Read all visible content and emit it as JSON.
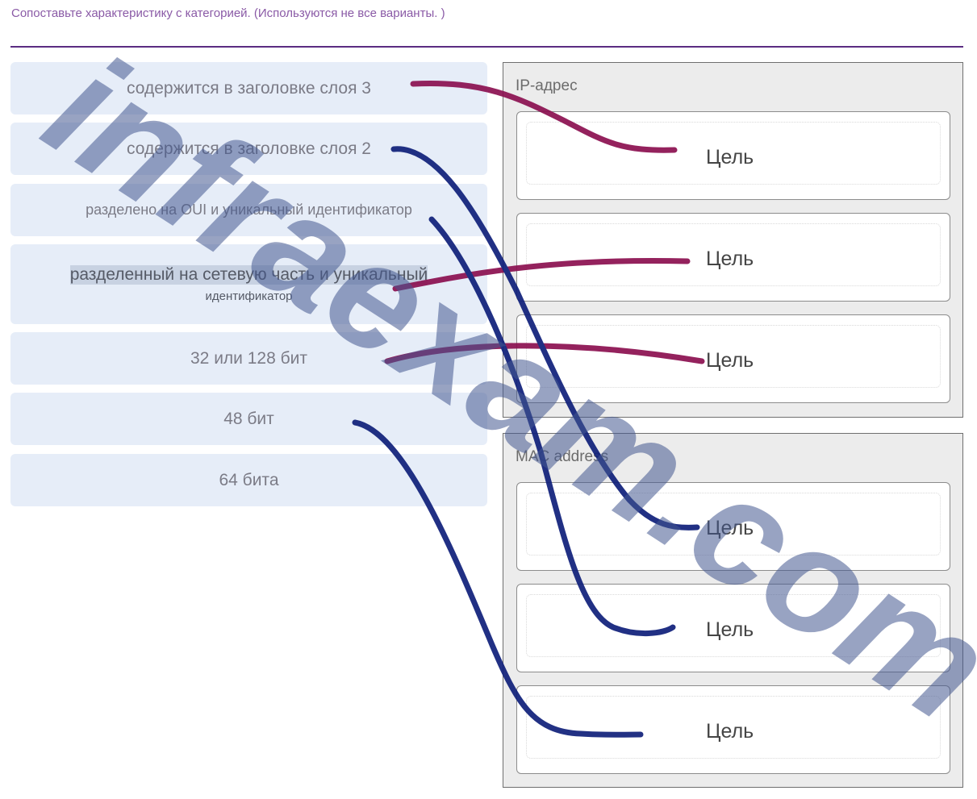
{
  "instruction": "Сопоставьте характеристику с категорией. (Используются не все варианты. )",
  "options": [
    {
      "text": "содержится в заголовке слоя 3"
    },
    {
      "text": "содержится в заголовке слоя 2"
    },
    {
      "text": "разделено на OUI и уникальный идентификатор"
    },
    {
      "text": "разделенный на сетевую часть и уникальный",
      "text2": "идентификатор"
    },
    {
      "text": "32 или 128 бит"
    },
    {
      "text": "48 бит"
    },
    {
      "text": "64 бита"
    }
  ],
  "panels": [
    {
      "title": "IP-адрес",
      "targets": [
        "Цель",
        "Цель",
        "Цель"
      ]
    },
    {
      "title": "MAC address",
      "targets": [
        "Цель",
        "Цель",
        "Цель"
      ]
    }
  ],
  "watermark": "infraexam.com",
  "colors": {
    "ip_line": "#8b1050",
    "mac_line": "#0f1f7a",
    "watermark": "#44578f",
    "accent_rule": "#5b2d82"
  }
}
